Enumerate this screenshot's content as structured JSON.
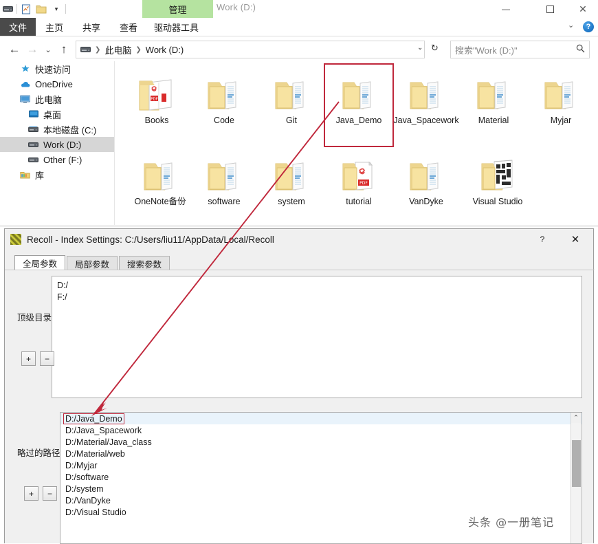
{
  "colors": {
    "ribbon_manage_bg": "#b5e3a0",
    "annotation_red": "#c0283c",
    "selected_sidebar": "#d6d6d6",
    "list_selected": "#e9f3fb",
    "folder_yellow": "#f5dd8d",
    "pdf_red": "#d92b2b"
  },
  "explorer": {
    "window_title": "Work (D:)",
    "quick_access_toolbar": [
      {
        "name": "drive-icon",
        "label": ""
      },
      {
        "name": "properties-icon",
        "label": ""
      },
      {
        "name": "new-folder-icon",
        "label": ""
      },
      {
        "name": "customize-dropdown-icon",
        "label": "▾"
      }
    ],
    "contextual_tab": "管理",
    "window_controls": {
      "minimize": "—",
      "maximize": "❑",
      "close": "✕"
    },
    "ribbon_tabs": [
      {
        "label": "文件",
        "active": true
      },
      {
        "label": "主页",
        "active": false
      },
      {
        "label": "共享",
        "active": false
      },
      {
        "label": "查看",
        "active": false
      },
      {
        "label": "驱动器工具",
        "active": false
      }
    ],
    "ribbon_collapse_icon": "⌄",
    "help_icon_label": "?",
    "navigation": {
      "back": "←",
      "forward": "→",
      "recent": "⌄",
      "up": "↑"
    },
    "address_bar": {
      "breadcrumbs": [
        "此电脑",
        "Work (D:)"
      ],
      "separator": "❯",
      "dropdown_icon": "⌄",
      "refresh_icon": "↻"
    },
    "search": {
      "placeholder": "搜索\"Work (D:)\"",
      "icon": "⚲"
    },
    "sidebar": {
      "items": [
        {
          "label": "快速访问",
          "icon": "star-icon",
          "indent": 0,
          "selected": false
        },
        {
          "label": "OneDrive",
          "icon": "cloud-icon",
          "indent": 0,
          "selected": false
        },
        {
          "label": "此电脑",
          "icon": "monitor-icon",
          "indent": 0,
          "selected": false
        },
        {
          "label": "桌面",
          "icon": "desktop-icon",
          "indent": 1,
          "selected": false
        },
        {
          "label": "本地磁盘 (C:)",
          "icon": "harddisk-icon",
          "indent": 1,
          "selected": false
        },
        {
          "label": "Work (D:)",
          "icon": "drive-icon",
          "indent": 1,
          "selected": true
        },
        {
          "label": "Other (F:)",
          "icon": "drive-icon",
          "indent": 1,
          "selected": false
        },
        {
          "label": "库",
          "icon": "library-icon",
          "indent": 0,
          "selected": false
        }
      ]
    },
    "files": [
      {
        "name": "Books",
        "icon": "folder-pdf-icon",
        "highlighted": false
      },
      {
        "name": "Code",
        "icon": "folder-docs-icon",
        "highlighted": false
      },
      {
        "name": "Git",
        "icon": "folder-docs-icon",
        "highlighted": false
      },
      {
        "name": "Java_Demo",
        "icon": "folder-docs-icon",
        "highlighted": true
      },
      {
        "name": "Java_Spacework",
        "icon": "folder-docs-icon",
        "highlighted": false
      },
      {
        "name": "Material",
        "icon": "folder-docs-icon",
        "highlighted": false
      },
      {
        "name": "Myjar",
        "icon": "folder-docs-icon",
        "highlighted": false
      },
      {
        "name": "OneNote备份",
        "icon": "folder-docs-icon",
        "highlighted": false
      },
      {
        "name": "software",
        "icon": "folder-docs-icon",
        "highlighted": false
      },
      {
        "name": "system",
        "icon": "folder-docs-icon",
        "highlighted": false
      },
      {
        "name": "tutorial",
        "icon": "folder-pdf-icon",
        "highlighted": false
      },
      {
        "name": "VanDyke",
        "icon": "folder-docs-icon",
        "highlighted": false
      },
      {
        "name": "Visual Studio",
        "icon": "folder-vs-icon",
        "highlighted": false
      }
    ]
  },
  "recoll": {
    "title": "Recoll - Index Settings: C:/Users/liu11/AppData/Local/Recoll",
    "logo_icon": "recoll-logo-icon",
    "help_button": "?",
    "close_button": "✕",
    "tabs": [
      {
        "label": "全局参数",
        "active": true
      },
      {
        "label": "局部参数",
        "active": false
      },
      {
        "label": "搜索参数",
        "active": false
      }
    ],
    "topdirs": {
      "label": "顶级目录",
      "items": [
        "D:/",
        "F:/"
      ],
      "add_button": "+",
      "remove_button": "−"
    },
    "skipped": {
      "label": "略过的路径",
      "items": [
        {
          "path": "D:/Java_Demo",
          "selected": true,
          "boxed": true
        },
        {
          "path": "D:/Java_Spacework",
          "selected": false,
          "boxed": false
        },
        {
          "path": "D:/Material/Java_class",
          "selected": false,
          "boxed": false
        },
        {
          "path": "D:/Material/web",
          "selected": false,
          "boxed": false
        },
        {
          "path": "D:/Myjar",
          "selected": false,
          "boxed": false
        },
        {
          "path": "D:/software",
          "selected": false,
          "boxed": false
        },
        {
          "path": "D:/system",
          "selected": false,
          "boxed": false
        },
        {
          "path": "D:/VanDyke",
          "selected": false,
          "boxed": false
        },
        {
          "path": "D:/Visual Studio",
          "selected": false,
          "boxed": false
        }
      ],
      "add_button": "+",
      "remove_button": "−",
      "scroll_up_icon": "⌃"
    }
  },
  "watermark": {
    "text": "头条 @一册笔记"
  }
}
